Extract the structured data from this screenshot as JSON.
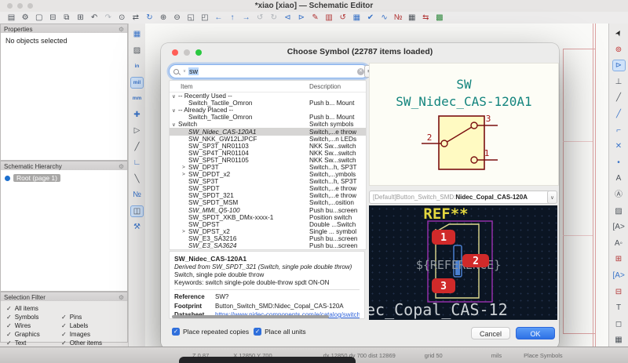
{
  "window": {
    "title": "*xiao [xiao] — Schematic Editor"
  },
  "top_toolbar": {
    "icons": [
      {
        "n": "save-icon",
        "g": "▤",
        "c": "dim"
      },
      {
        "n": "schematic-setup-icon",
        "g": "⚙",
        "c": "dim"
      },
      {
        "n": "page-settings-icon",
        "g": "▢",
        "c": "dim"
      },
      {
        "n": "print-icon",
        "g": "⊟",
        "c": "dim"
      },
      {
        "n": "plot-icon",
        "g": "⧉",
        "c": "dim"
      },
      {
        "n": "paste-icon",
        "g": "⊞",
        "c": "dim"
      },
      {
        "n": "undo-icon",
        "g": "↶",
        "c": "dim"
      },
      {
        "n": "redo-icon",
        "g": "↷",
        "c": "faint"
      },
      {
        "n": "find-icon",
        "g": "⊙",
        "c": "dim"
      },
      {
        "n": "find-replace-icon",
        "g": "⇄",
        "c": "dim"
      },
      {
        "n": "refresh-icon",
        "g": "↻",
        "c": "blue"
      },
      {
        "n": "zoom-in-icon",
        "g": "⊕",
        "c": "dim"
      },
      {
        "n": "zoom-out-icon",
        "g": "⊖",
        "c": "dim"
      },
      {
        "n": "zoom-fit-icon",
        "g": "◱",
        "c": "dim"
      },
      {
        "n": "zoom-selection-icon",
        "g": "◰",
        "c": "dim"
      },
      {
        "n": "nav-back-icon",
        "g": "←",
        "c": "blue"
      },
      {
        "n": "nav-up-icon",
        "g": "↑",
        "c": "blue"
      },
      {
        "n": "nav-forward-icon",
        "g": "→",
        "c": "blue"
      },
      {
        "n": "rotate-ccw-icon",
        "g": "↺",
        "c": "faint"
      },
      {
        "n": "rotate-cw-icon",
        "g": "↻",
        "c": "faint"
      },
      {
        "n": "mirror-v-icon",
        "g": "⊲",
        "c": "blue"
      },
      {
        "n": "mirror-h-icon",
        "g": "⊳",
        "c": "blue"
      },
      {
        "n": "edit-symbol-icon",
        "g": "✎",
        "c": "reded"
      },
      {
        "n": "edit-library-icon",
        "g": "▥",
        "c": "reded"
      },
      {
        "n": "update-symbols-icon",
        "g": "↺",
        "c": "reded"
      },
      {
        "n": "symbol-fields-table-icon",
        "g": "▦",
        "c": "blue"
      },
      {
        "n": "erc-icon",
        "g": "✔",
        "c": "blue"
      },
      {
        "n": "simulator-icon",
        "g": "∿",
        "c": "blue"
      },
      {
        "n": "annotate-icon",
        "g": "№",
        "c": "reded"
      },
      {
        "n": "net-table-icon",
        "g": "▦",
        "c": "dim"
      },
      {
        "n": "footprint-assign-icon",
        "g": "⇆",
        "c": "reded"
      },
      {
        "n": "pcb-editor-icon",
        "g": "▩",
        "c": "green"
      }
    ]
  },
  "left_toolbar": {
    "icons": [
      {
        "n": "grid-visibility-icon",
        "g": "▦",
        "c": "blue"
      },
      {
        "n": "grid-overrides-icon",
        "g": "▨",
        "c": "dim"
      },
      {
        "n": "units-inches-button",
        "g": "in",
        "c": "txt"
      },
      {
        "n": "units-mils-button",
        "g": "mil",
        "c": "txt",
        "sel": true
      },
      {
        "n": "units-mm-button",
        "g": "mm",
        "c": "txt"
      },
      {
        "n": "cursor-shape-icon",
        "g": "✚",
        "c": "blue"
      },
      {
        "n": "hidden-pins-icon",
        "g": "▷",
        "c": "dim"
      },
      {
        "n": "free-angle-wires-icon",
        "g": "╱",
        "c": "dim"
      },
      {
        "n": "hv-wires-icon",
        "g": "∟",
        "c": "blue"
      },
      {
        "n": "45deg-wires-icon",
        "g": "╲",
        "c": "dim"
      },
      {
        "n": "annotate-auto-icon",
        "g": "№",
        "c": "blue"
      },
      {
        "n": "properties-panel-toggle",
        "g": "◫",
        "c": "dim",
        "sel": true
      },
      {
        "n": "net-tools-icon",
        "g": "⚒",
        "c": "blue"
      }
    ]
  },
  "right_toolbar": {
    "icons": [
      {
        "n": "select-tool",
        "g": "➤",
        "c": "cursor"
      },
      {
        "n": "highlight-net-tool",
        "g": "⊚",
        "c": "red"
      },
      {
        "n": "add-symbol-tool",
        "g": "⊳",
        "c": "blue",
        "sel": true
      },
      {
        "n": "add-power-tool",
        "g": "⊥",
        "c": "dim"
      },
      {
        "n": "add-wire-tool",
        "g": "╱",
        "c": "dim"
      },
      {
        "n": "add-bus-tool",
        "g": "╱",
        "c": "blue"
      },
      {
        "n": "bus-entry-tool",
        "g": "⌐",
        "c": "blue"
      },
      {
        "n": "no-connect-tool",
        "g": "✕",
        "c": "blue"
      },
      {
        "n": "junction-tool",
        "g": "•",
        "c": "blue"
      },
      {
        "n": "net-label-tool",
        "g": "A",
        "c": "dim"
      },
      {
        "n": "global-label-tool",
        "g": "Ⓐ",
        "c": "dim"
      },
      {
        "n": "rule-area-tool",
        "g": "▨",
        "c": "dim"
      },
      {
        "n": "hier-label-tool",
        "g": "[A>",
        "c": "dim"
      },
      {
        "n": "netclass-directive-tool",
        "g": "A◦",
        "c": "dim"
      },
      {
        "n": "add-sheet-tool",
        "g": "⊞",
        "c": "reded"
      },
      {
        "n": "sheet-pin-tool",
        "g": "[A>",
        "c": "blue"
      },
      {
        "n": "import-sheet-pin-tool",
        "g": "⊟",
        "c": "reded"
      },
      {
        "n": "text-tool",
        "g": "T",
        "c": "dim"
      },
      {
        "n": "textbox-tool",
        "g": "◻",
        "c": "dim"
      },
      {
        "n": "table-tool",
        "g": "▦",
        "c": "dim"
      },
      {
        "n": "rectangle-tool",
        "g": "▭",
        "c": "dim"
      }
    ]
  },
  "panels": {
    "properties": {
      "title": "Properties",
      "gear_glyph": "⚙",
      "empty_text": "No objects selected"
    },
    "hierarchy": {
      "title": "Schematic Hierarchy",
      "gear_glyph": "⚙",
      "root_label": "Root (page 1)"
    },
    "selection_filter": {
      "title": "Selection Filter",
      "gear_glyph": "⚙",
      "check_glyph": "✓",
      "items": [
        {
          "label": "All items",
          "full": true
        },
        {
          "label": "Symbols"
        },
        {
          "label": "Pins"
        },
        {
          "label": "Wires"
        },
        {
          "label": "Labels"
        },
        {
          "label": "Graphics"
        },
        {
          "label": "Images"
        },
        {
          "label": "Text"
        },
        {
          "label": "Other items"
        }
      ]
    }
  },
  "dialog": {
    "title": "Choose Symbol (22787 items loaded)",
    "check_glyph": "✓",
    "search": {
      "value": "sw",
      "clear_glyph": "✕",
      "filter_glyph": "≡+",
      "chevron_glyph": "∨"
    },
    "columns": [
      "Item",
      "Description"
    ],
    "tree": [
      {
        "chevron": "∨",
        "label": "-- Recently Used --",
        "desc": ""
      },
      {
        "child": true,
        "label": "Switch_Tactile_Omron",
        "desc": "Push b... Mount"
      },
      {
        "chevron": "∨",
        "label": "-- Already Placed --",
        "desc": ""
      },
      {
        "child": true,
        "label": "Switch_Tactile_Omron",
        "desc": "Push b... Mount"
      },
      {
        "chevron": "∨",
        "label": "Switch",
        "desc": "Switch symbols"
      },
      {
        "child": true,
        "ital": true,
        "selected": true,
        "label": "SW_Nidec_CAS-120A1",
        "desc": "Switch,...e throw"
      },
      {
        "child": true,
        "label": "SW_NKK_GW12LJPCF",
        "desc": "Switch,...n LEDs"
      },
      {
        "child": true,
        "label": "SW_SP3T_NR01103",
        "desc": "NKK Sw...switch"
      },
      {
        "child": true,
        "label": "SW_SP4T_NR01104",
        "desc": "NKK Sw...switch"
      },
      {
        "child": true,
        "label": "SW_SP5T_NR01105",
        "desc": "NKK Sw...switch"
      },
      {
        "child": true,
        "chevron": ">",
        "label": "SW_DP3T",
        "desc": "Switch...h, SP3T"
      },
      {
        "child": true,
        "chevron": ">",
        "label": "SW_DPDT_x2",
        "desc": "Switch,...ymbols"
      },
      {
        "child": true,
        "label": "SW_SP3T",
        "desc": "Switch...h, SP3T"
      },
      {
        "child": true,
        "label": "SW_SPDT",
        "desc": "Switch,...e throw"
      },
      {
        "child": true,
        "label": "SW_SPDT_321",
        "desc": "Switch,...e throw"
      },
      {
        "child": true,
        "label": "SW_SPDT_MSM",
        "desc": "Switch,...osition"
      },
      {
        "child": true,
        "ital": true,
        "label": "SW_MMI_Q5-100",
        "desc": "Push bu...screen"
      },
      {
        "child": true,
        "label": "SW_SPDT_XKB_DMx-xxxx-1",
        "desc": "Position switch"
      },
      {
        "child": true,
        "label": "SW_DPST",
        "desc": "Double ...Switch"
      },
      {
        "child": true,
        "chevron": ">",
        "label": "SW_DPST_x2",
        "desc": "Single ... symbol"
      },
      {
        "child": true,
        "label": "SW_E3_SA3216",
        "desc": "Push bu...screen"
      },
      {
        "child": true,
        "ital": true,
        "label": "SW_E3_SA3624",
        "desc": "Push bu...screen"
      }
    ],
    "details": {
      "name": "SW_Nidec_CAS-120A1",
      "derived": "Derived from SW_SPDT_321 (Switch, single pole double throw)",
      "description": "Switch, single pole double throw",
      "keywords": "Keywords: switch single-pole double-throw spdt ON-ON",
      "fields": [
        {
          "label": "Reference",
          "value": "SW?"
        },
        {
          "label": "Footprint",
          "value": "Button_Switch_SMD:Nidec_Copal_CAS-120A"
        },
        {
          "label": "Datasheet",
          "value": "https://www.nidec-components.com/e/catalog/switch/cas",
          "link": true
        }
      ]
    },
    "symbol_preview": {
      "ref": "SW",
      "name": "SW_Nidec_CAS-120A1",
      "pin1": "1",
      "pin2": "2",
      "pin3": "3"
    },
    "footprint_select": {
      "prefix": "[Default] ",
      "library": "Button_Switch_SMD:",
      "name": "Nidec_Copal_CAS-120A",
      "chevron_glyph": "∨"
    },
    "footprint_preview": {
      "ref_text": "REF**",
      "reference_var": "${REFERENCE}",
      "name_text": "ec_Copal_CAS-12",
      "pad1": "1",
      "pad2": "2",
      "pad3": "3"
    },
    "checkboxes": [
      {
        "label": "Place repeated copies",
        "checked": true
      },
      {
        "label": "Place all units",
        "checked": true
      }
    ],
    "buttons": {
      "cancel": "Cancel",
      "ok": "OK"
    }
  },
  "status_bar": {
    "fields": [
      {
        "t": "Z 0.87"
      },
      {
        "t": "X 12850 Y 700"
      },
      {
        "t": "dx 12850  dy 700  dist 12869"
      },
      {
        "t": "grid 50"
      },
      {
        "t": "mils"
      },
      {
        "t": "Place Symbols"
      }
    ]
  }
}
